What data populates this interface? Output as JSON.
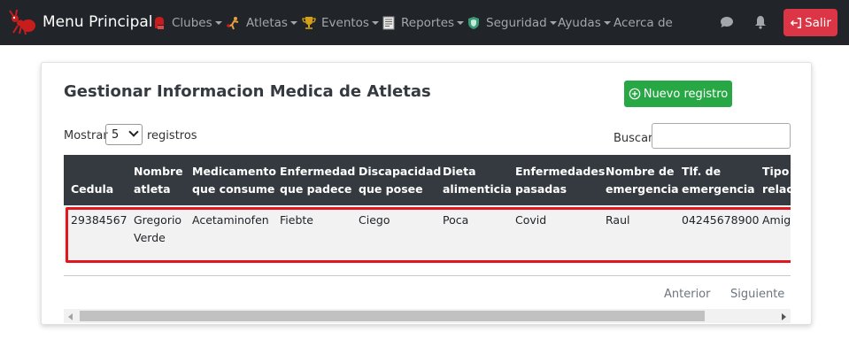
{
  "navbar": {
    "brand": "Menu Principal",
    "menu": [
      {
        "label": "Clubes",
        "icon": "boxing-glove-icon",
        "has_dropdown": true
      },
      {
        "label": "Atletas",
        "icon": "boxer-icon",
        "has_dropdown": true
      },
      {
        "label": "Eventos",
        "icon": "trophy-icon",
        "has_dropdown": true
      },
      {
        "label": "Reportes",
        "icon": "report-icon",
        "has_dropdown": true
      },
      {
        "label": "Seguridad",
        "icon": "shield-icon",
        "has_dropdown": true
      },
      {
        "label": "Ayudas",
        "icon": "",
        "has_dropdown": true
      },
      {
        "label": "Acerca de",
        "icon": "",
        "has_dropdown": false
      }
    ],
    "right_icons": [
      "chat-icon",
      "bell-icon"
    ],
    "logout_label": "Salir"
  },
  "card": {
    "title": "Gestionar Informacion Medica de Atletas",
    "new_button": "Nuevo registro",
    "length": {
      "before": "Mostrar",
      "value": "5",
      "after": "registros"
    },
    "search_label": "Buscar:",
    "search_value": ""
  },
  "table": {
    "columns": [
      [
        "Cedula"
      ],
      [
        "Nombre",
        "atleta"
      ],
      [
        "Medicamento",
        "que consume"
      ],
      [
        "Enfermedad",
        "que padece"
      ],
      [
        "Discapacidad",
        "que posee"
      ],
      [
        "Dieta",
        "alimenticia"
      ],
      [
        "Enfermedades",
        "pasadas"
      ],
      [
        "Nombre de",
        "emergencia"
      ],
      [
        "Tlf. de",
        "emergencia"
      ],
      [
        "Tipo de",
        "relación"
      ]
    ],
    "rows": [
      [
        [
          "29384567"
        ],
        [
          "Gregorio",
          "Verde"
        ],
        [
          "Acetaminofen"
        ],
        [
          "Fiebte"
        ],
        [
          "Ciego"
        ],
        [
          "Poca"
        ],
        [
          "Covid"
        ],
        [
          "Raul"
        ],
        [
          "04245678900"
        ],
        [
          "Amigo"
        ]
      ]
    ]
  },
  "pagination": {
    "previous": "Anterior",
    "next": "Siguiente"
  },
  "colors": {
    "navbar": "#212529",
    "logout": "#dc3545",
    "new": "#28a745",
    "table_head": "#343a40",
    "highlight": "#e2161e"
  }
}
